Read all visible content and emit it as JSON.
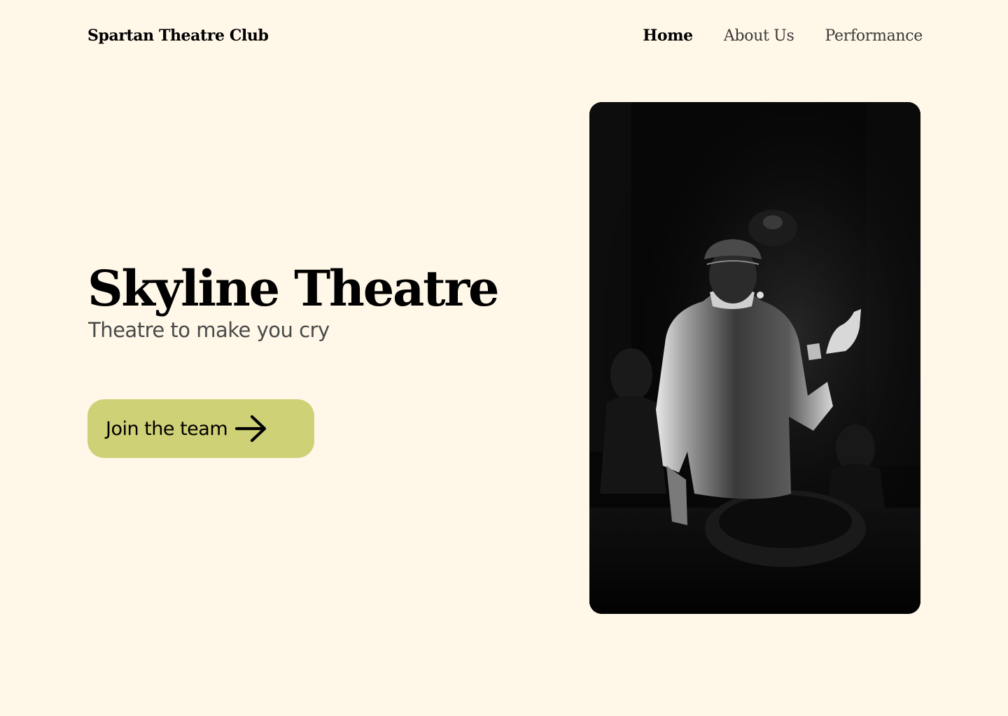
{
  "brand": {
    "name": "Spartan Theatre Club"
  },
  "nav": {
    "items": [
      {
        "label": "Home",
        "active": true
      },
      {
        "label": "About Us",
        "active": false
      },
      {
        "label": "Performance",
        "active": false
      }
    ]
  },
  "hero": {
    "title": "Skyline Theatre",
    "subtitle": "Theatre to make you cry",
    "cta_label": "Join the team",
    "cta_icon": "arrow-right-icon",
    "image_subject": "performer-on-stage-photo"
  },
  "colors": {
    "background": "#fff7e8",
    "cta_background": "#cfd176",
    "text_primary": "#000000",
    "text_secondary": "#4a4a4a"
  }
}
